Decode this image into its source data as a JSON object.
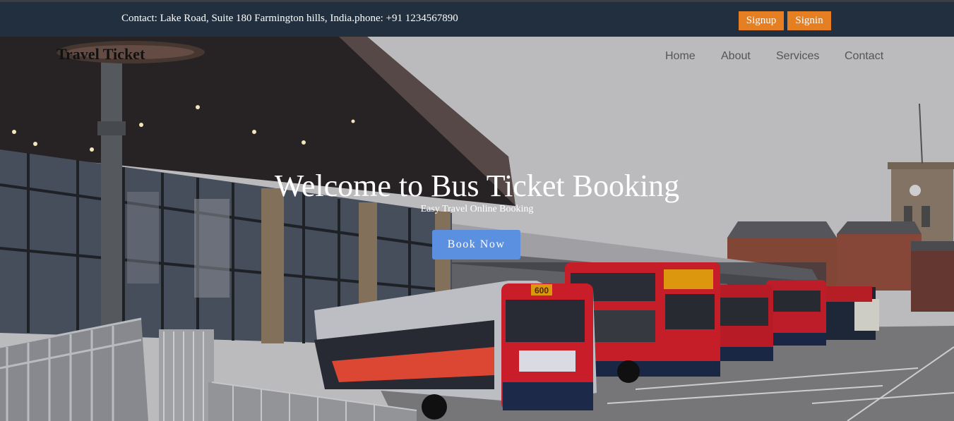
{
  "topbar": {
    "contact_text": "Contact: Lake Road, Suite 180 Farmington hills, India.phone: +91 1234567890",
    "signup_label": "Signup",
    "signin_label": "Signin",
    "button_color": "#e67e22",
    "background_color": "#222f3e"
  },
  "header": {
    "brand": "Travel Ticket",
    "nav": [
      "Home",
      "About",
      "Services",
      "Contact"
    ]
  },
  "hero": {
    "title": "Welcome to Bus Ticket Booking",
    "subtitle": "Easy Travel Online Booking",
    "cta_label": "Book Now",
    "cta_color": "#5b8fe0",
    "bus_route_sign": "600"
  }
}
